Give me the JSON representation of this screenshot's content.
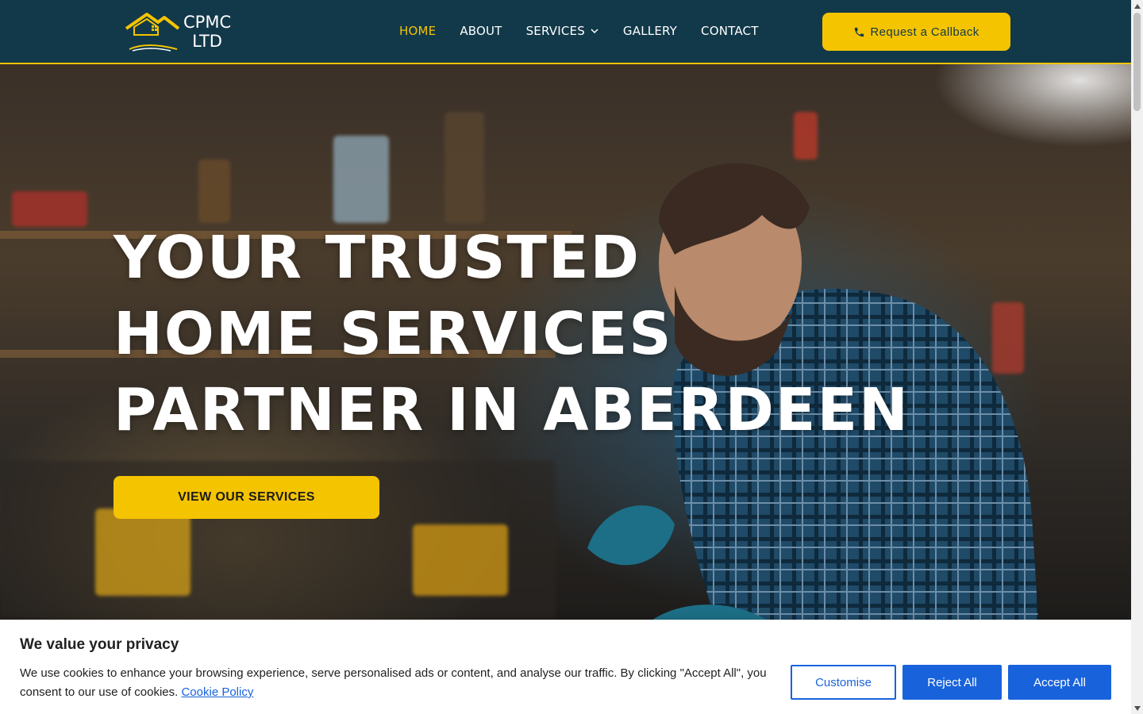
{
  "header": {
    "logo_line1": "CPMC",
    "logo_line2": "LTD",
    "nav": [
      {
        "label": "HOME",
        "active": true
      },
      {
        "label": "ABOUT"
      },
      {
        "label": "SERVICES",
        "has_dropdown": true
      },
      {
        "label": "GALLERY"
      },
      {
        "label": "CONTACT"
      }
    ],
    "cta_label": "Request a Callback",
    "cta_icon": "phone-icon"
  },
  "hero": {
    "title_lines": [
      "YOUR TRUSTED",
      "HOME SERVICES",
      "PARTNER IN ABERDEEN"
    ],
    "button_label": "VIEW OUR SERVICES"
  },
  "cookie": {
    "title": "We value your privacy",
    "text": "We use cookies to enhance your browsing experience, serve personalised ads or content, and analyse our traffic. By clicking \"Accept All\", you consent to our use of cookies.",
    "link_label": "Cookie Policy",
    "customise_label": "Customise",
    "reject_label": "Reject All",
    "accept_label": "Accept All"
  },
  "colors": {
    "header_bg": "#12394a",
    "accent_yellow": "#f5c400",
    "cookie_blue": "#1863dc"
  }
}
